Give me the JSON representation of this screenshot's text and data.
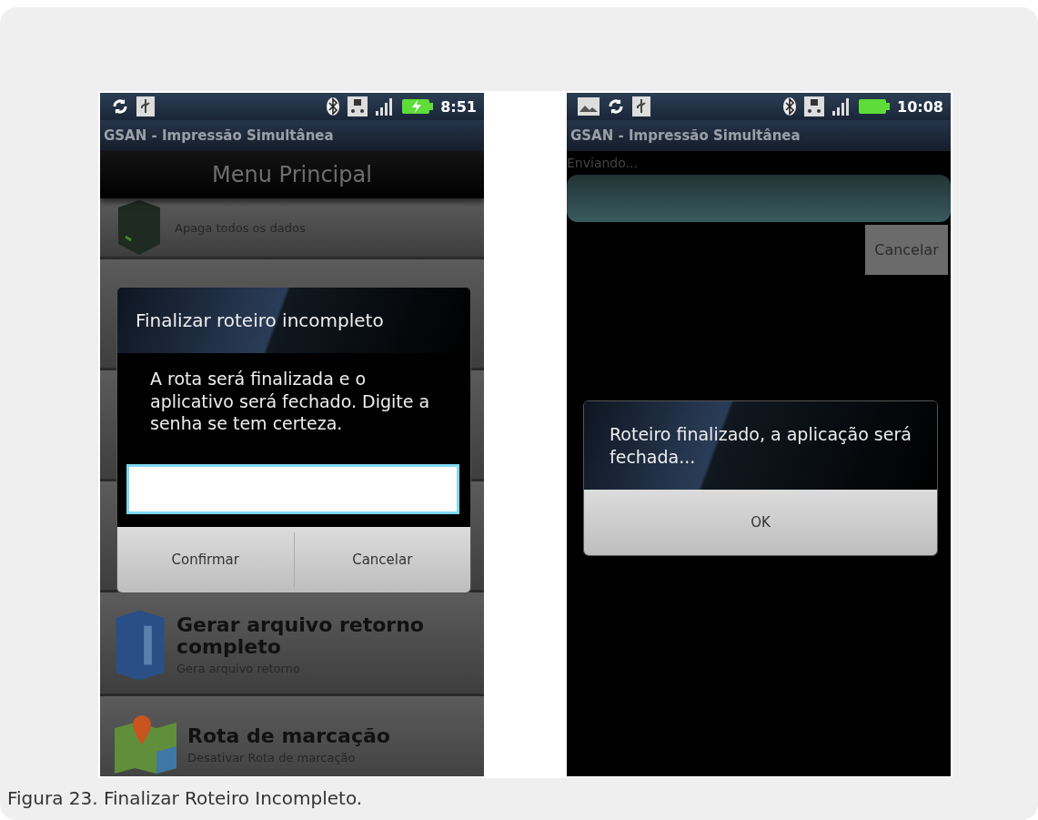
{
  "screens": [
    {
      "kind": "menu",
      "status_bar": {
        "charging": true,
        "time": "8:51"
      },
      "app_title": "GSAN - Impressão Simultânea",
      "header": "Menu Principal",
      "menu_items": [
        {
          "kind": "subtitle_only",
          "subtitle": "Apaga todos os dados"
        },
        {
          "kind": "full",
          "title": "Gerar arquivo retorno completo",
          "subtitle": "Gera arquivo retorno"
        },
        {
          "kind": "full",
          "title": "Rota de marcação",
          "subtitle": "Desativar Rota de marcação"
        }
      ],
      "dialog": {
        "title": "Finalizar roteiro incompleto",
        "message": "A rota será finalizada e o aplicativo será fechado. Digite a senha se tem certeza.",
        "password_field": {
          "focused": true
        },
        "buttons": [
          "Confirmar",
          "Cancelar"
        ]
      }
    },
    {
      "kind": "progress",
      "status_bar": {
        "charging": false,
        "time": "10:08"
      },
      "app_title": "GSAN - Impressão Simultânea",
      "progress": {
        "label": "Enviando...",
        "level": 1
      },
      "cancel_button": "Cancelar",
      "dialog": {
        "message": "Roteiro finalizado, a aplicação será fechada...",
        "buttons": [
          "OK"
        ]
      }
    }
  ],
  "caption": "Figura 23. Finalizar Roteiro Incompleto."
}
